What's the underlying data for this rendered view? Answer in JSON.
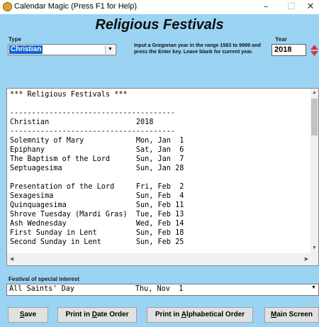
{
  "window": {
    "title": "Calendar Magic (Press F1 for Help)",
    "minimize": "–",
    "maximize": "☐",
    "close": "✕"
  },
  "heading": "Religious Festivals",
  "type_field": {
    "label": "Type",
    "value": "Christian"
  },
  "year_field": {
    "label": "Year",
    "value": "2018",
    "hint": "Input a Gregorian year in the range 1583 to 9999 and press the Enter key. Leave blank for current year."
  },
  "results": {
    "lines": [
      "*** Religious Festivals ***",
      "",
      "--------------------------------------",
      "Christian                    2018",
      "--------------------------------------",
      "Solemnity of Mary            Mon, Jan  1",
      "Epiphany                     Sat, Jan  6",
      "The Baptism of the Lord      Sun, Jan  7",
      "Septuagesima                 Sun, Jan 28",
      "",
      "Presentation of the Lord     Fri, Feb  2",
      "Sexagesima                   Sun, Feb  4",
      "Quinquagesima                Sun, Feb 11",
      "Shrove Tuesday (Mardi Gras)  Tue, Feb 13",
      "Ash Wednesday                Wed, Feb 14",
      "First Sunday in Lent         Sun, Feb 18",
      "Second Sunday in Lent        Sun, Feb 25"
    ]
  },
  "festival_of_interest": {
    "label": "Festival of special interest",
    "value": "All Saints' Day              Thu, Nov  1"
  },
  "buttons": {
    "save": {
      "pre": "",
      "key": "S",
      "post": "ave"
    },
    "print_date": {
      "pre": "Print in ",
      "key": "D",
      "post": "ate Order"
    },
    "print_alpha": {
      "pre": "Print in ",
      "key": "A",
      "post": "lphabetical Order"
    },
    "main_screen": {
      "pre": "",
      "key": "M",
      "post": "ain Screen"
    }
  },
  "colors": {
    "background": "#9bd3f3",
    "selection": "#0a64d8",
    "spinner": "#d9343a"
  }
}
